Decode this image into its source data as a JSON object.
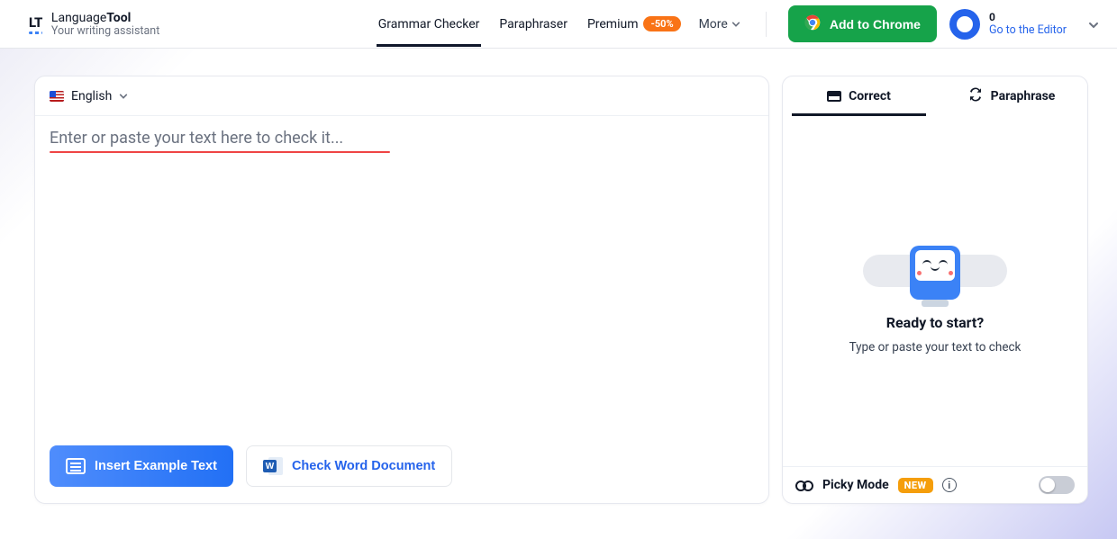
{
  "brand": {
    "logo_text": "LT",
    "name_a": "Language",
    "name_b": "Tool",
    "tagline": "Your writing assistant"
  },
  "nav": {
    "grammar": "Grammar Checker",
    "paraphraser": "Paraphraser",
    "premium": "Premium",
    "discount": "-50%",
    "more": "More"
  },
  "header_actions": {
    "add_chrome": "Add to Chrome",
    "profile_count": "0",
    "profile_goto": "Go to the Editor"
  },
  "editor": {
    "language": "English",
    "placeholder": "Enter or paste your text here to check it...",
    "insert_example": "Insert Example Text",
    "check_word": "Check Word Document",
    "word_badge": "W"
  },
  "side": {
    "tab_correct": "Correct",
    "tab_paraphrase": "Paraphrase",
    "ready_title": "Ready to start?",
    "ready_sub": "Type or paste your text to check",
    "picky_label": "Picky Mode",
    "picky_new": "NEW",
    "info_letter": "i"
  }
}
